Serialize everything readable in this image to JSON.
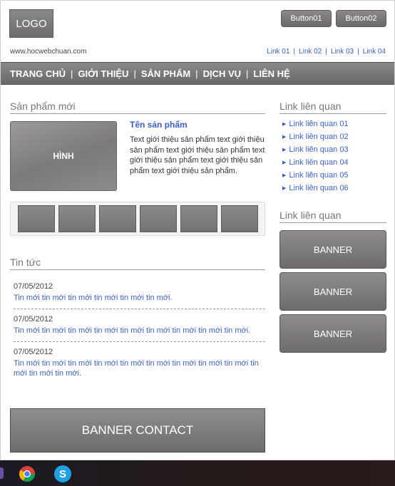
{
  "header": {
    "logo": "LOGO",
    "button1": "Button01",
    "button2": "Button02",
    "site_url": "www.hocwebchuan.com",
    "top_links": [
      "Link 01",
      "Link 02",
      "Link 03",
      "Link 04"
    ]
  },
  "nav": [
    "TRANG CHỦ",
    "GIỚI THIỆU",
    "SẢN PHẨM",
    "DỊCH VỤ",
    "LIÊN HỆ"
  ],
  "products": {
    "title": "Sản phẩm mới",
    "image_label": "HÌNH",
    "name": "Tên sản phẩm",
    "description": "Text giới thiệu sản phẩm text giới thiệu sản phẩm text giới thiệu sản phẩm text giới thiệu sản phẩm text giới thiệu sản phẩm text giới thiệu sản phẩm."
  },
  "news": {
    "title": "Tin tức",
    "items": [
      {
        "date": "07/05/2012",
        "text": "Tin mới tin mới tin mới tin mới tin mới tin mới."
      },
      {
        "date": "07/05/2012",
        "text": "Tin mới tin mới tin mới tin mới tin mới tin mới tin mới tin mới tin mới."
      },
      {
        "date": "07/05/2012",
        "text": "Tin mới tin mới tin mới tin mới tin mới tin mới tin mới tin mới tin mới tin mới tin mới tin mới."
      }
    ]
  },
  "banner_contact": "BANNER CONTACT",
  "sidebar": {
    "related_title": "Link liên quan",
    "related_links": [
      "Link liên quan 01",
      "Link liên quan 02",
      "Link liên quan 03",
      "Link liên quan 04",
      "Link liên quan 05",
      "Link liên quan 06"
    ],
    "banner_title": "Link liên quan",
    "banners": [
      "BANNER",
      "BANNER",
      "BANNER"
    ]
  },
  "taskbar": {
    "icons": [
      "chrome-icon",
      "skype-icon"
    ],
    "skype_glyph": "S"
  },
  "colors": {
    "link": "#3a5fcd",
    "nav_bg": "#7a7777",
    "taskbar_bg": "#1f1a1f"
  }
}
